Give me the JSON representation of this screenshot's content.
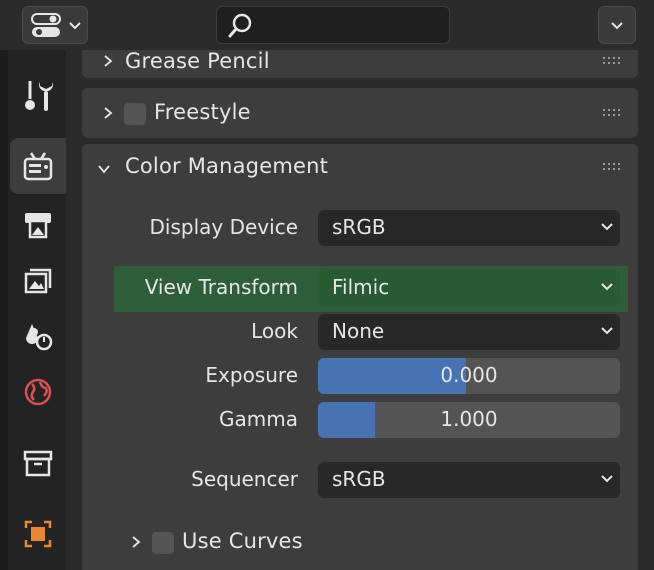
{
  "header": {
    "editor_type_icon": "properties-editor-icon",
    "search": {
      "value": "",
      "icon": "search-icon"
    },
    "options_icon": "chevron-down-icon"
  },
  "sidebar": {
    "tabs": [
      {
        "name": "tool",
        "icon": "tool-icon",
        "active": false
      },
      {
        "name": "render",
        "icon": "render-icon",
        "active": true
      },
      {
        "name": "output",
        "icon": "output-icon",
        "active": false
      },
      {
        "name": "view-layer",
        "icon": "view-layer-icon",
        "active": false
      },
      {
        "name": "scene",
        "icon": "scene-icon",
        "active": false
      },
      {
        "name": "world",
        "icon": "world-icon",
        "active": false
      },
      {
        "name": "collection",
        "icon": "collection-icon",
        "active": false
      },
      {
        "name": "object",
        "icon": "object-icon",
        "active": false
      }
    ]
  },
  "panels": {
    "grease_pencil": {
      "label": "Grease Pencil",
      "expanded": false
    },
    "freestyle": {
      "label": "Freestyle",
      "expanded": false,
      "checked": false
    },
    "color_management": {
      "label": "Color Management",
      "expanded": true,
      "display_device": {
        "label": "Display Device",
        "value": "sRGB"
      },
      "view_transform": {
        "label": "View Transform",
        "value": "Filmic",
        "highlight_color": "#2e5e38"
      },
      "look": {
        "label": "Look",
        "value": "None"
      },
      "exposure": {
        "label": "Exposure",
        "value": "0.000",
        "fill_fraction": 0.49
      },
      "gamma": {
        "label": "Gamma",
        "value": "1.000",
        "fill_fraction": 0.19
      },
      "sequencer": {
        "label": "Sequencer",
        "value": "sRGB"
      },
      "use_curves": {
        "label": "Use Curves",
        "checked": false,
        "expanded": false
      }
    }
  },
  "colors": {
    "accent_blue": "#4772b3",
    "highlight_green": "#2e5e38",
    "panel_bg": "#3d3d3d"
  }
}
